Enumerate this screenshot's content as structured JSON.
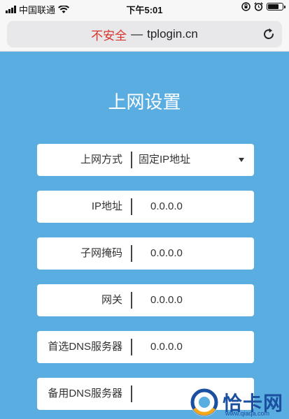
{
  "status_bar": {
    "carrier": "中国联通",
    "time": "下午5:01",
    "icons": [
      "signal-icon",
      "wifi-icon",
      "lock-rotation-icon",
      "alarm-icon",
      "battery-icon"
    ],
    "battery_level": 0.8
  },
  "browser": {
    "security_text": "不安全",
    "separator": "—",
    "domain": "tplogin.cn",
    "reload_icon": "reload-icon"
  },
  "page": {
    "title": "上网设置",
    "fields": [
      {
        "label": "上网方式",
        "value": "固定IP地址",
        "type": "select"
      },
      {
        "label": "IP地址",
        "value": "0.0.0.0",
        "type": "input"
      },
      {
        "label": "子网掩码",
        "value": "0.0.0.0",
        "type": "input"
      },
      {
        "label": "网关",
        "value": "0.0.0.0",
        "type": "input"
      },
      {
        "label": "首选DNS服务器",
        "value": "0.0.0.0",
        "type": "input"
      },
      {
        "label": "备用DNS服务器",
        "value": "",
        "type": "input"
      }
    ]
  },
  "watermark": {
    "text": "恰卡网",
    "url": "www.qiaqa.com"
  },
  "colors": {
    "background": "#5aade0",
    "insecure": "#d8332d",
    "watermark": "#1b4fa0"
  }
}
